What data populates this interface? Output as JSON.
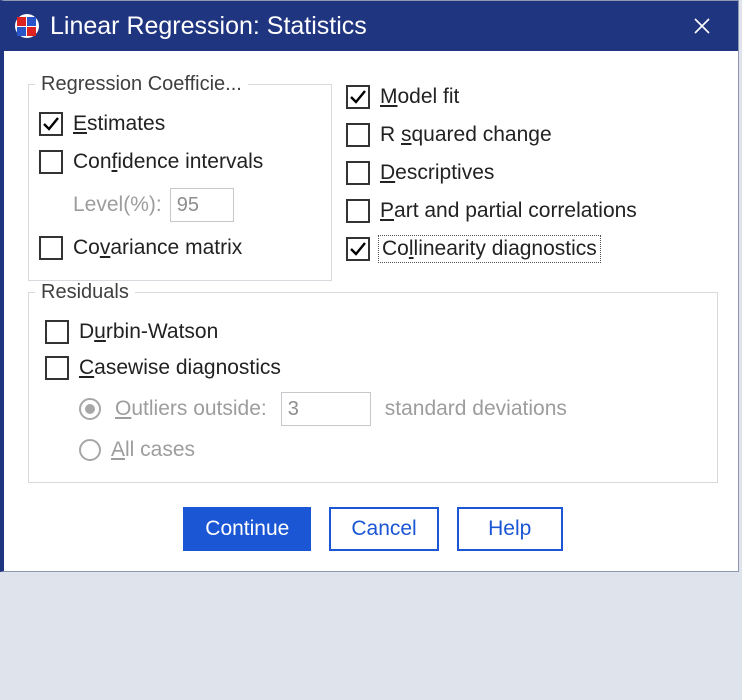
{
  "window": {
    "title": "Linear Regression: Statistics"
  },
  "groups": {
    "coefficients": {
      "legend": "Regression Coefficie...",
      "estimates": {
        "label": "Estimates",
        "ulChar": "E",
        "rest": "stimates",
        "checked": true
      },
      "confidence": {
        "label": "Confidence intervals",
        "pre": "Con",
        "ulChar": "f",
        "rest": "idence intervals",
        "checked": false
      },
      "level": {
        "label": "Level(%):",
        "value": "95"
      },
      "covariance": {
        "label": "Covariance matrix",
        "pre": "Co",
        "ulChar": "v",
        "rest": "ariance matrix",
        "checked": false
      }
    },
    "right": {
      "model_fit": {
        "ulChar": "M",
        "rest": "odel fit",
        "checked": true
      },
      "r_squared": {
        "pre": "R ",
        "ulChar": "s",
        "rest": "quared change",
        "checked": false
      },
      "descriptives": {
        "ulChar": "D",
        "rest": "escriptives",
        "checked": false
      },
      "part_partial": {
        "ulChar": "P",
        "rest": "art and partial correlations",
        "checked": false
      },
      "collinearity": {
        "pre": "Co",
        "ulChar": "l",
        "rest": "linearity diagnostics",
        "checked": true
      }
    },
    "residuals": {
      "legend": "Residuals",
      "durbin": {
        "pre": "D",
        "ulChar": "u",
        "rest": "rbin-Watson",
        "checked": false
      },
      "casewise": {
        "ulChar": "C",
        "rest": "asewise diagnostics",
        "checked": false
      },
      "outliers": {
        "label_pre": "",
        "label_ul": "O",
        "label_rest": "utliers outside:",
        "value": "3",
        "suffix": "standard deviations",
        "selected": true
      },
      "allcases": {
        "ulChar": "A",
        "rest": "ll cases",
        "selected": false
      }
    }
  },
  "buttons": {
    "continue": {
      "ulChar": "C",
      "rest": "ontinue"
    },
    "cancel": "Cancel",
    "help": "Help"
  }
}
